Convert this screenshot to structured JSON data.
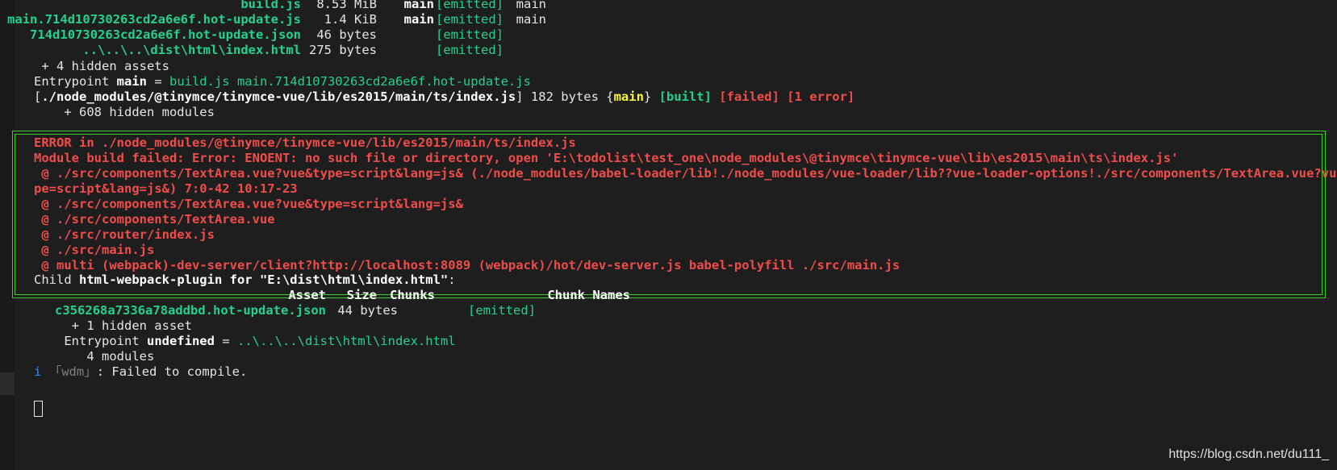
{
  "assets": [
    {
      "name": "build.js",
      "size": "8.53 MiB",
      "chunks": "main",
      "status": "[emitted]",
      "names": "main"
    },
    {
      "name": "main.714d10730263cd2a6e6f.hot-update.js",
      "size": "1.4 KiB",
      "chunks": "main",
      "status": "[emitted]",
      "names": "main"
    },
    {
      "name": "714d10730263cd2a6e6f.hot-update.json",
      "size": "46 bytes",
      "chunks": "",
      "status": "[emitted]",
      "names": ""
    },
    {
      "name": "..\\..\\..\\dist\\html\\index.html",
      "size": "275 bytes",
      "chunks": "",
      "status": "[emitted]",
      "names": ""
    }
  ],
  "hidden_assets": " + 4 hidden assets",
  "entrypoint": {
    "prefix": "Entrypoint ",
    "name": "main",
    "eq": " = ",
    "files": "build.js main.714d10730263cd2a6e6f.hot-update.js"
  },
  "module_line": {
    "open": "[",
    "path": "./node_modules/@tinymce/tinymce-vue/lib/es2015/main/ts/index.js",
    "close": "]",
    "size": " 182 bytes {",
    "chunk": "main",
    "chunk_close": "}",
    "built": "[built]",
    "failed": "[failed]",
    "error": "[1 error]"
  },
  "hidden_modules": "    + 608 hidden modules",
  "error_lines": [
    "ERROR in ./node_modules/@tinymce/tinymce-vue/lib/es2015/main/ts/index.js",
    "Module build failed: Error: ENOENT: no such file or directory, open 'E:\\todolist\\test_one\\node_modules\\@tinymce\\tinymce-vue\\lib\\es2015\\main\\ts\\index.js'",
    " @ ./src/components/TextArea.vue?vue&type=script&lang=js& (./node_modules/babel-loader/lib!./node_modules/vue-loader/lib??vue-loader-options!./src/components/TextArea.vue?vue&ty",
    "pe=script&lang=js&) 7:0-42 10:17-23",
    " @ ./src/components/TextArea.vue?vue&type=script&lang=js&",
    " @ ./src/components/TextArea.vue",
    " @ ./src/router/index.js",
    " @ ./src/main.js",
    " @ multi (webpack)-dev-server/client?http://localhost:8089 (webpack)/hot/dev-server.js babel-polyfill ./src/main.js"
  ],
  "child": {
    "prefix": "Child ",
    "name": "html-webpack-plugin for \"E:\\dist\\html\\index.html\"",
    "suffix": ":"
  },
  "child_header": {
    "asset": "Asset",
    "size": "Size",
    "chunks": "Chunks",
    "names": "Chunk Names"
  },
  "child_asset": {
    "name": "c356268a7336a78addbd.hot-update.json",
    "size": "44 bytes",
    "status": "[emitted]"
  },
  "child_hidden": "     + 1 hidden asset",
  "child_entry": {
    "prefix": "    Entrypoint ",
    "name": "undefined",
    "eq": " = ",
    "files": "..\\..\\..\\dist\\html\\index.html"
  },
  "child_modules": "       4 modules",
  "wdm": {
    "icon": "i",
    "open": " 「",
    "tag": "wdm",
    "close": "」",
    "msg": ": Failed to compile."
  },
  "watermark": "https://blog.csdn.net/du111_"
}
